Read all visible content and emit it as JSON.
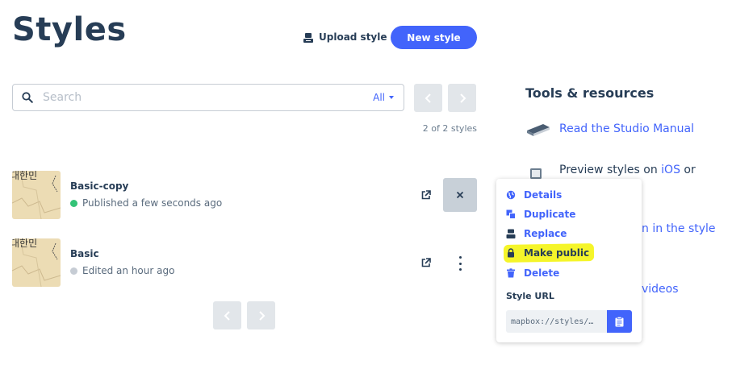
{
  "header": {
    "title": "Styles",
    "upload_label": "Upload style",
    "new_label": "New style"
  },
  "search": {
    "placeholder": "Search",
    "value": "",
    "filter_label": "All"
  },
  "pagination": {
    "count_text": "2 of 2 styles"
  },
  "styles": [
    {
      "name": "Basic-copy",
      "status": "Published a few seconds ago",
      "status_color": "#33c377"
    },
    {
      "name": "Basic",
      "status": "Edited an hour ago",
      "status_color": "#c6ccd4"
    }
  ],
  "thumb_text": "대한민",
  "tools": {
    "title": "Tools & resources",
    "items": [
      {
        "text": "Read the Studio Manual"
      },
      {
        "pre": "Preview styles on ",
        "link": "iOS",
        "post": " or"
      },
      {
        "text": "n in the style"
      },
      {
        "text": "videos"
      }
    ]
  },
  "menu": {
    "items": [
      {
        "label": "Details",
        "icon": "globe-icon"
      },
      {
        "label": "Duplicate",
        "icon": "duplicate-icon"
      },
      {
        "label": "Replace",
        "icon": "upload-icon"
      },
      {
        "label": "Make public",
        "icon": "lock-icon"
      },
      {
        "label": "Delete",
        "icon": "trash-icon"
      }
    ],
    "url_label": "Style URL",
    "url_value": "mapbox://styles/…"
  },
  "colors": {
    "accent": "#4264fb",
    "text": "#273d56",
    "highlight": "#f5f52a"
  }
}
